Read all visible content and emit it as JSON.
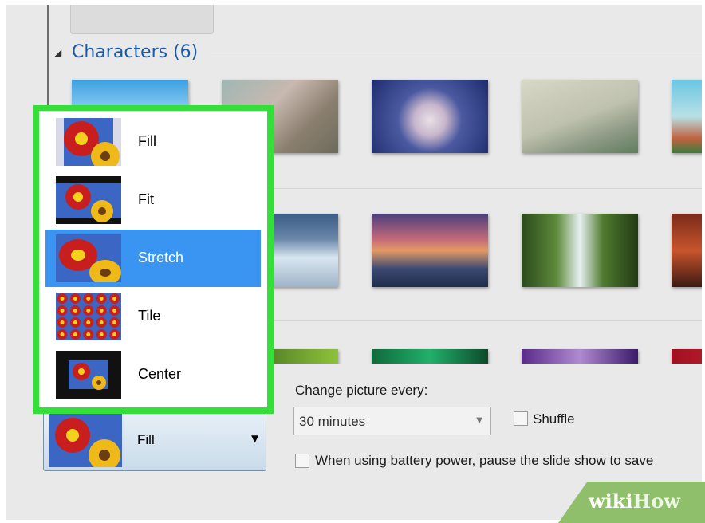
{
  "group": {
    "arrow": "◢",
    "label": "Characters (6)"
  },
  "picture_position": {
    "options": [
      {
        "label": "Fill",
        "icon": "flower-fill-icon"
      },
      {
        "label": "Fit",
        "icon": "flower-fit-icon"
      },
      {
        "label": "Stretch",
        "icon": "flower-stretch-icon"
      },
      {
        "label": "Tile",
        "icon": "flower-tile-icon"
      },
      {
        "label": "Center",
        "icon": "flower-center-icon"
      }
    ],
    "selected_index": 2,
    "current": "Fill",
    "caret": "▼"
  },
  "slideshow": {
    "change_label": "Change picture every:",
    "interval": "30 minutes",
    "shuffle_label": "Shuffle",
    "battery_label": "When using battery power, pause the slide show to save"
  },
  "watermark": {
    "wiki": "wiki",
    "how": "How"
  },
  "colors": {
    "highlight": "#3a94f2",
    "annotation": "#33e037",
    "group_label": "#1d5aa6"
  }
}
